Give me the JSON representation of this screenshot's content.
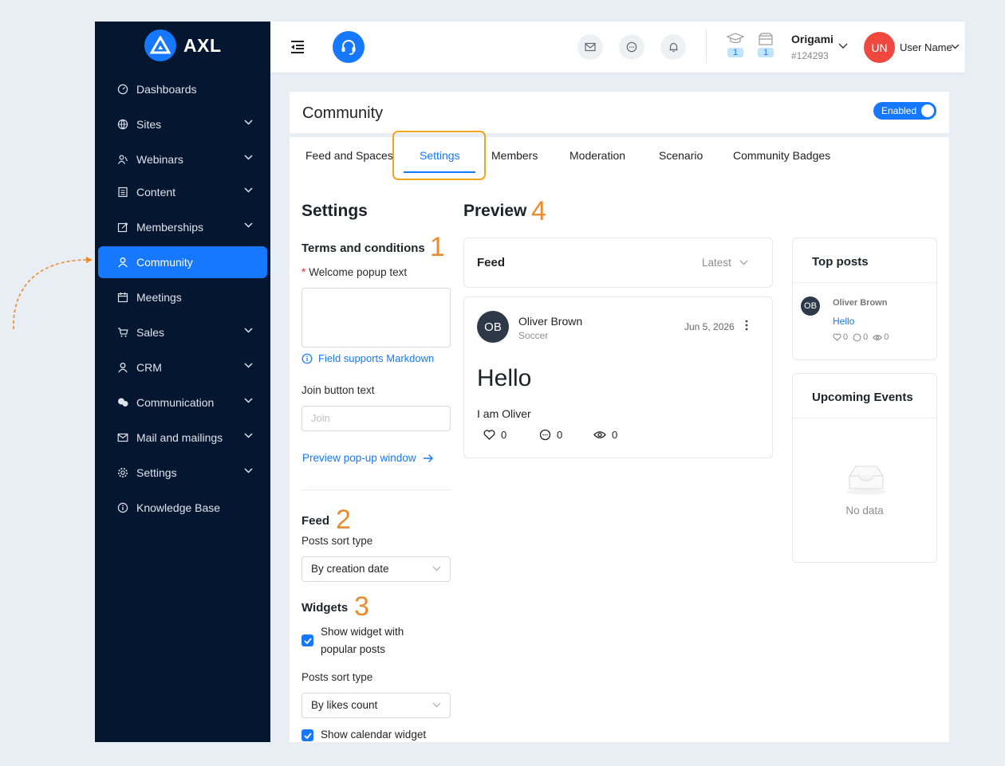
{
  "brand": {
    "name": "AXL",
    "accent": "#1677ff",
    "sidebar_bg": "#051630",
    "annotation_color": "#e98c2e"
  },
  "sidebar": {
    "items": [
      {
        "label": "Dashboards",
        "icon": "dashboard-icon",
        "has_chevron": false,
        "active": false
      },
      {
        "label": "Sites",
        "icon": "globe-icon",
        "has_chevron": true,
        "active": false
      },
      {
        "label": "Webinars",
        "icon": "webinar-icon",
        "has_chevron": true,
        "active": false
      },
      {
        "label": "Content",
        "icon": "content-icon",
        "has_chevron": true,
        "active": false
      },
      {
        "label": "Memberships",
        "icon": "edit-icon",
        "has_chevron": true,
        "active": false
      },
      {
        "label": "Community",
        "icon": "user-icon",
        "has_chevron": false,
        "active": true
      },
      {
        "label": "Meetings",
        "icon": "calendar-icon",
        "has_chevron": false,
        "active": false
      },
      {
        "label": "Sales",
        "icon": "cart-icon",
        "has_chevron": true,
        "active": false
      },
      {
        "label": "CRM",
        "icon": "user-icon",
        "has_chevron": true,
        "active": false
      },
      {
        "label": "Communication",
        "icon": "chat-bubbles-icon",
        "has_chevron": true,
        "active": false
      },
      {
        "label": "Mail and mailings",
        "icon": "mail-icon",
        "has_chevron": true,
        "active": false
      },
      {
        "label": "Settings",
        "icon": "gear-icon",
        "has_chevron": true,
        "active": false
      },
      {
        "label": "Knowledge Base",
        "icon": "info-icon",
        "has_chevron": false,
        "active": false
      }
    ]
  },
  "header": {
    "courses_count": "1",
    "products_count": "1",
    "org_name": "Origami",
    "org_id": "#124293",
    "user_initials": "UN",
    "user_name": "User Name"
  },
  "page": {
    "title": "Community",
    "toggle_label": "Enabled",
    "tabs": [
      {
        "label": "Feed and Spaces",
        "active": false
      },
      {
        "label": "Settings",
        "active": true
      },
      {
        "label": "Members",
        "active": false
      },
      {
        "label": "Moderation",
        "active": false
      },
      {
        "label": "Scenario",
        "active": false
      },
      {
        "label": "Community Badges",
        "active": false
      }
    ]
  },
  "settings": {
    "heading": "Settings",
    "terms_heading": "Terms and conditions",
    "welcome_label": "Welcome popup text",
    "welcome_value": "",
    "markdown_hint": "Field supports Markdown",
    "join_label": "Join button text",
    "join_placeholder": "Join",
    "preview_link": "Preview pop-up window",
    "feed_heading": "Feed",
    "feed_sort_label": "Posts sort type",
    "feed_sort_value": "By creation date",
    "widgets_heading": "Widgets",
    "popular_widget_label": "Show widget with popular posts",
    "popular_widget_checked": true,
    "widget_sort_label": "Posts sort type",
    "widget_sort_value": "By likes count",
    "calendar_widget_label": "Show calendar widget",
    "calendar_widget_checked": true
  },
  "annotations": {
    "terms": "1",
    "feed": "2",
    "widgets": "3",
    "preview": "4"
  },
  "preview": {
    "heading": "Preview",
    "feed_title": "Feed",
    "feed_sort": "Latest",
    "post": {
      "initials": "OB",
      "author": "Oliver Brown",
      "space": "Soccer",
      "date": "Jun 5, 2026",
      "title": "Hello",
      "body": "I am Oliver",
      "likes": "0",
      "comments": "0",
      "views": "0"
    },
    "top_posts": {
      "title": "Top posts",
      "initials": "OB",
      "author": "Oliver Brown",
      "post_title": "Hello",
      "likes": "0",
      "comments": "0",
      "views": "0"
    },
    "events": {
      "title": "Upcoming Events",
      "empty_text": "No data"
    }
  }
}
